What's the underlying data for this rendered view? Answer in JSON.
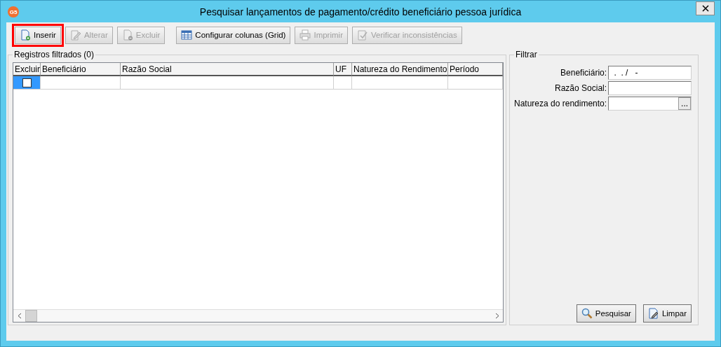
{
  "window": {
    "title": "Pesquisar lançamentos de pagamento/crédito beneficiário pessoa jurídica",
    "app_badge": "G5"
  },
  "toolbar": [
    {
      "label": "Inserir",
      "kind": "insert",
      "disabled": false,
      "highlighted": true
    },
    {
      "label": "Alterar",
      "kind": "edit",
      "disabled": true,
      "highlighted": false
    },
    {
      "label": "Excluir",
      "kind": "delete",
      "disabled": true,
      "highlighted": false
    },
    {
      "label": "Configurar colunas (Grid)",
      "kind": "grid",
      "disabled": false,
      "highlighted": false
    },
    {
      "label": "Imprimir",
      "kind": "print",
      "disabled": true,
      "highlighted": false
    },
    {
      "label": "Verificar inconsistências",
      "kind": "check",
      "disabled": true,
      "highlighted": false
    }
  ],
  "records": {
    "title": "Registros filtrados (0)",
    "columns": [
      "Excluir",
      "Beneficiário",
      "Razão Social",
      "UF",
      "Natureza do Rendimento",
      "Período"
    ],
    "rows": [
      {
        "checked": false,
        "selected": true
      }
    ]
  },
  "filter": {
    "title": "Filtrar",
    "fields": [
      {
        "label": "Beneficiário:",
        "value": " .  . /   -",
        "kind": "text"
      },
      {
        "label": "Razão Social:",
        "kind": "text"
      },
      {
        "label": "Natureza do rendimento:",
        "kind": "lookup",
        "button": "..."
      }
    ],
    "buttons": [
      {
        "label": "Pesquisar",
        "kind": "search"
      },
      {
        "label": "Limpar",
        "kind": "clear"
      }
    ]
  }
}
